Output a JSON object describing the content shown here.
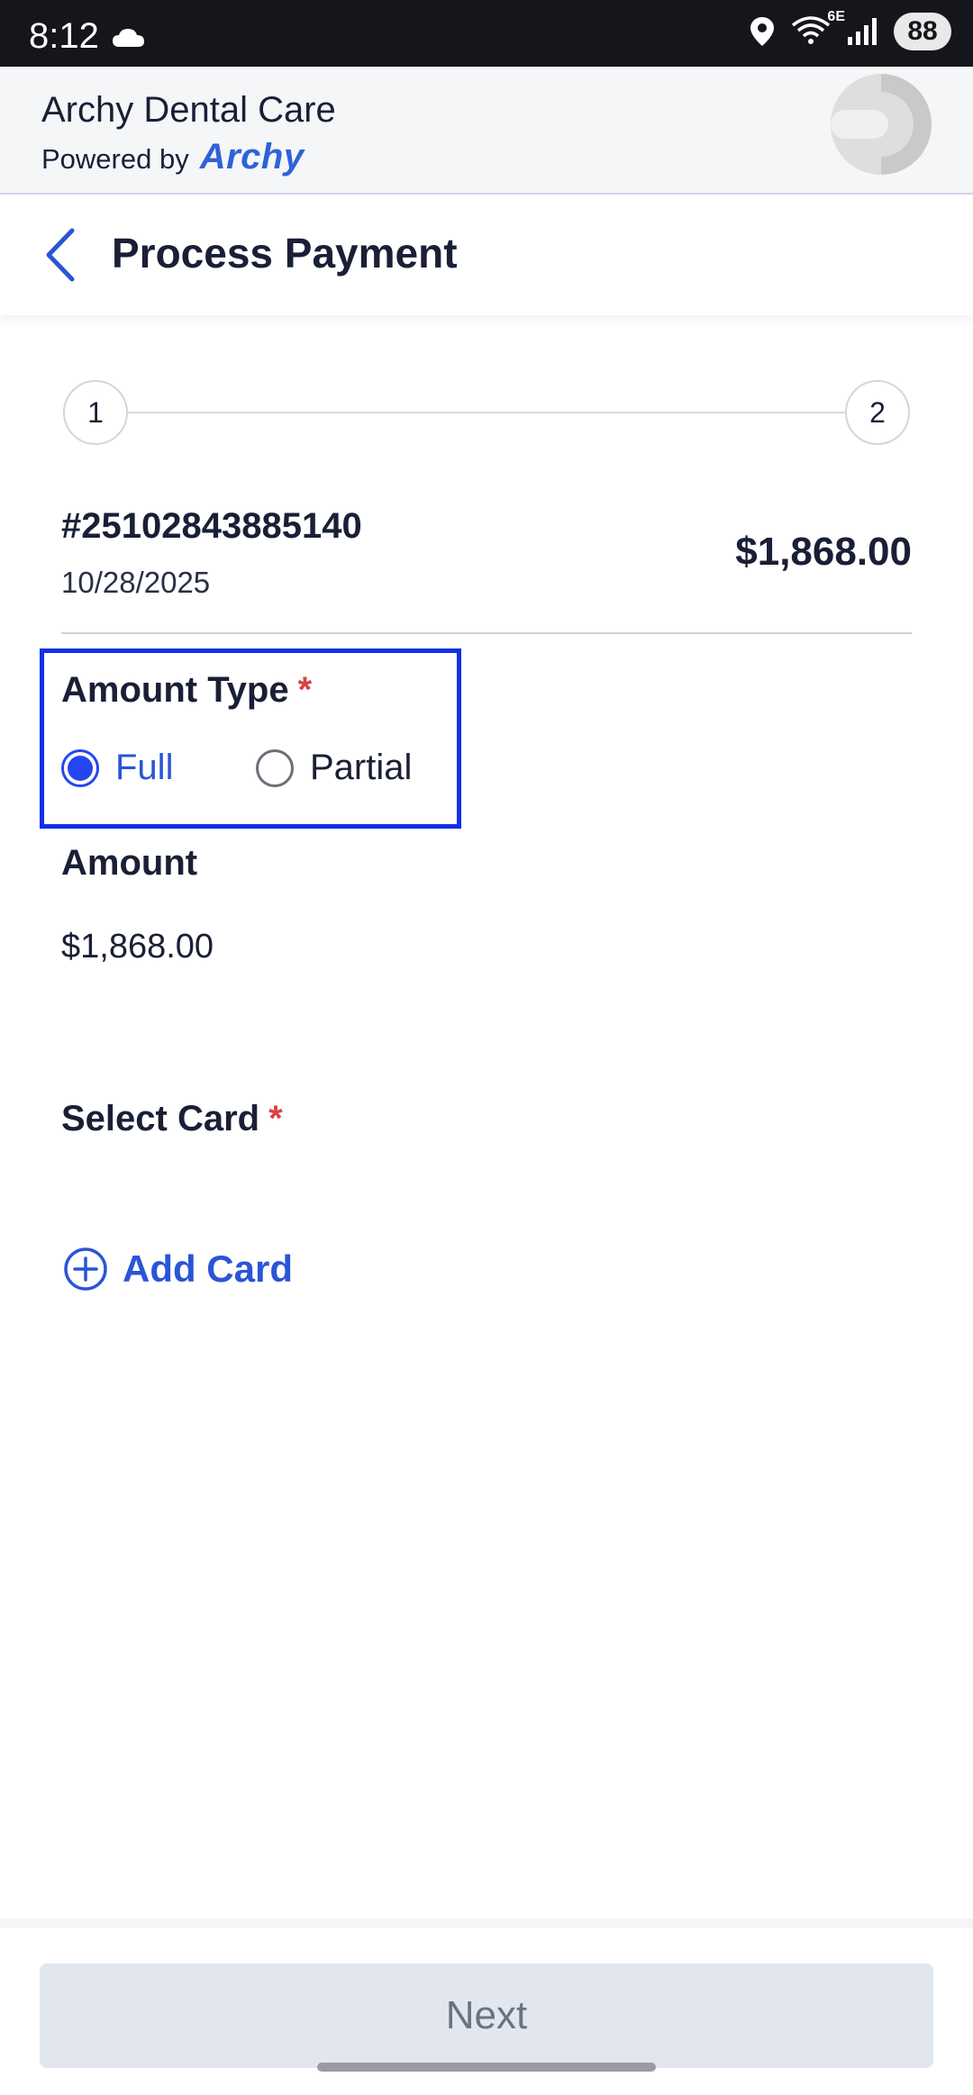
{
  "status_bar": {
    "time": "8:12",
    "battery": "88",
    "network_label": "6E"
  },
  "app_header": {
    "title": "Archy Dental Care",
    "powered_by": "Powered by",
    "brand": "Archy"
  },
  "page": {
    "title": "Process Payment"
  },
  "stepper": {
    "steps": [
      "1",
      "2"
    ],
    "current_step": 1
  },
  "invoice": {
    "number": "#25102843885140",
    "date": "10/28/2025",
    "total": "$1,868.00"
  },
  "amount_type": {
    "label": "Amount Type",
    "required_mark": "*",
    "options": [
      {
        "label": "Full",
        "selected": true
      },
      {
        "label": "Partial",
        "selected": false
      }
    ]
  },
  "amount": {
    "label": "Amount",
    "value": "$1,868.00"
  },
  "select_card": {
    "label": "Select Card",
    "required_mark": "*",
    "add_card_label": "Add Card"
  },
  "footer": {
    "next_label": "Next",
    "next_enabled": false
  },
  "colors": {
    "accent": "#2a55d6",
    "highlight_box": "#1030e8",
    "required": "#d94141",
    "disabled_button": "#e2e7ef"
  }
}
